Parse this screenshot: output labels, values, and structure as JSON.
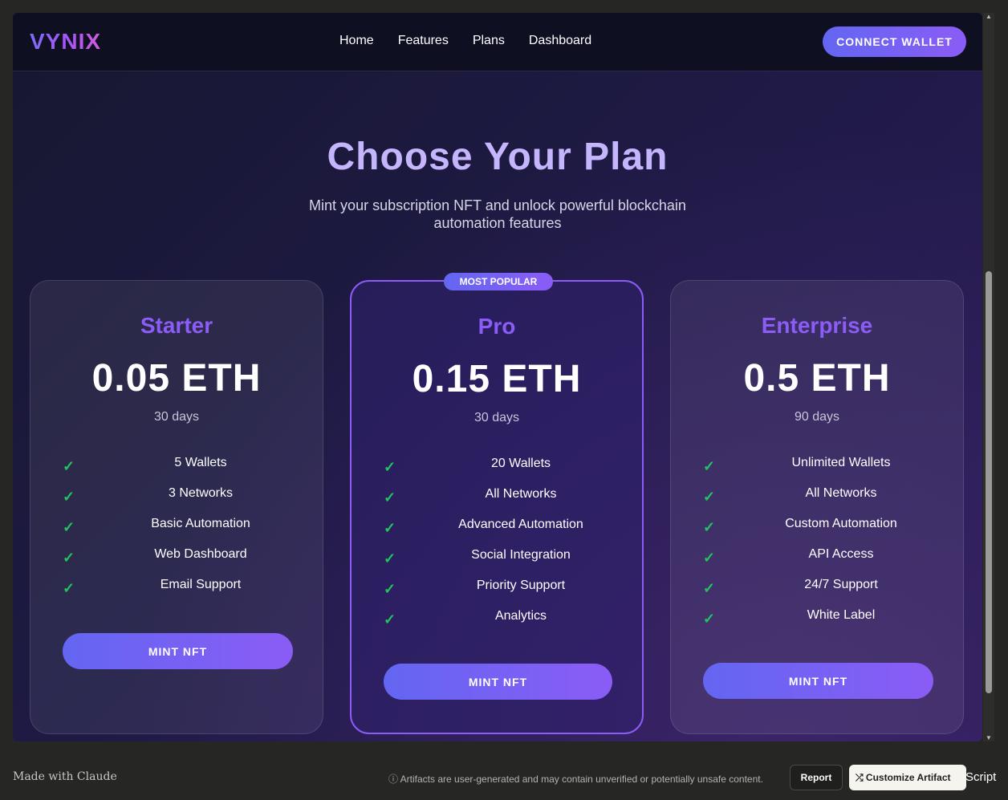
{
  "brand": {
    "logo": "VYNIX"
  },
  "nav": {
    "links": [
      "Home",
      "Features",
      "Plans",
      "Dashboard"
    ],
    "connect_label": "CONNECT WALLET"
  },
  "hero": {
    "title": "Choose Your Plan",
    "subtitle": "Mint your subscription NFT and unlock powerful blockchain automation features"
  },
  "plans": [
    {
      "name": "Starter",
      "price": "0.05 ETH",
      "period": "30 days",
      "features": [
        "5 Wallets",
        "3 Networks",
        "Basic Automation",
        "Web Dashboard",
        "Email Support"
      ],
      "cta": "MINT NFT"
    },
    {
      "name": "Pro",
      "badge": "MOST POPULAR",
      "price": "0.15 ETH",
      "period": "30 days",
      "features": [
        "20 Wallets",
        "All Networks",
        "Advanced Automation",
        "Social Integration",
        "Priority Support",
        "Analytics"
      ],
      "cta": "MINT NFT"
    },
    {
      "name": "Enterprise",
      "price": "0.5 ETH",
      "period": "90 days",
      "features": [
        "Unlimited Wallets",
        "All Networks",
        "Custom Automation",
        "API Access",
        "24/7 Support",
        "White Label"
      ],
      "cta": "MINT NFT"
    }
  ],
  "check_symbol": "✓",
  "footer": {
    "made_with": "Made with Claude",
    "disclaimer": "ⓘ Artifacts are user-generated and may contain unverified or potentially unsafe content.",
    "report_label": "Report",
    "customize_label": "⤮ Customize Artifact",
    "trailing_text": "Script"
  },
  "colors": {
    "accent": "#8b5cf6",
    "accent_start": "#6366f1",
    "title": "#c4b5fd",
    "check": "#22c55e",
    "nav_bg": "#0f0f22"
  }
}
